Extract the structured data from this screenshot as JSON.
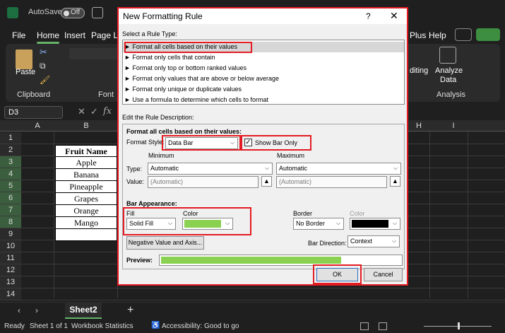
{
  "app": {
    "autosave_label": "AutoSave",
    "toggle_state": "Off",
    "menu": [
      "File",
      "Home",
      "Insert",
      "Page La",
      "Plus",
      "Help"
    ],
    "ribbon": {
      "paste_label": "Paste",
      "clipboard_label": "Clipboard",
      "font_label": "Font",
      "editing_label": "diting",
      "analyze_label_1": "Analyze",
      "analyze_label_2": "Data",
      "analysis_label": "Analysis"
    },
    "name_box": "D3",
    "fx": "fx",
    "columns": [
      "A",
      "B",
      "H",
      "I"
    ],
    "rows": [
      "1",
      "2",
      "3",
      "4",
      "5",
      "6",
      "7",
      "8",
      "9",
      "10",
      "11",
      "12",
      "13",
      "14"
    ],
    "fruit_table": {
      "header": "Fruit Name",
      "items": [
        "Apple",
        "Banana",
        "Pineapple",
        "Grapes",
        "Orange",
        "Mango"
      ]
    },
    "sheet_tab": "Sheet2",
    "add_sheet": "+",
    "status": {
      "ready": "Ready",
      "sheet": "Sheet 1 of 1",
      "workbook_stats": "Workbook Statistics",
      "accessibility": "Accessibility: Good to go"
    }
  },
  "dialog": {
    "title": "New Formatting Rule",
    "help": "?",
    "close": "✕",
    "select_type_label": "Select a Rule Type:",
    "rule_types": [
      "Format all cells based on their values",
      "Format only cells that contain",
      "Format only top or bottom ranked values",
      "Format only values that are above or below average",
      "Format only unique or duplicate values",
      "Use a formula to determine which cells to format"
    ],
    "edit_desc_label": "Edit the Rule Description:",
    "format_all_label": "Format all cells based on their values:",
    "format_style_label": "Format Style:",
    "format_style_value": "Data Bar",
    "show_bar_only_label": "Show Bar Only",
    "show_bar_only_checked": true,
    "minimum_label": "Minimum",
    "maximum_label": "Maximum",
    "type_label": "Type:",
    "value_label": "Value:",
    "min_type": "Automatic",
    "max_type": "Automatic",
    "min_value": "(Automatic)",
    "max_value": "(Automatic)",
    "bar_appearance_label": "Bar Appearance:",
    "fill_label": "Fill",
    "color_label": "Color",
    "border_label": "Border",
    "border_color_label": "Color",
    "fill_value": "Solid Fill",
    "fill_color": "#8bd151",
    "border_value": "No Border",
    "border_color": "#000000",
    "negative_button": "Negative Value and Axis...",
    "bar_direction_label": "Bar Direction:",
    "bar_direction_value": "Context",
    "preview_label": "Preview:",
    "ok": "OK",
    "cancel": "Cancel"
  }
}
